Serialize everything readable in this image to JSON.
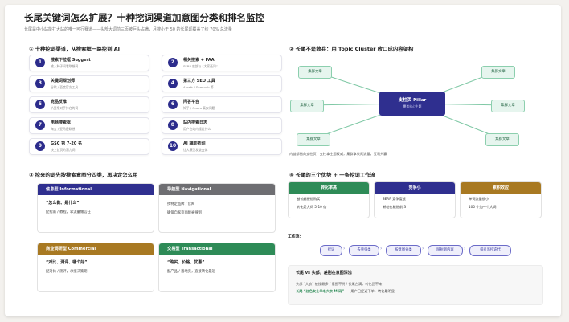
{
  "title": "长尾关键词怎么扩展？十种挖词渠道加意图分类和排名监控",
  "subtitle": "长尾是中小站能打大站的唯一可行赛道——头部大词前三页被巨头占满，月搜小于 50 的长尾却覆盖了约 70% 总流量",
  "section1": {
    "heading": "① 十种挖词渠道，从搜索框一路挖到 AI",
    "cards": [
      {
        "num": "1",
        "title": "搜索下拉框 Suggest",
        "sub": "输入种子词看联想词"
      },
      {
        "num": "2",
        "title": "相关搜索 + PAA",
        "sub": "SERP 底部与 “大家还问”"
      },
      {
        "num": "3",
        "title": "关键词规划师",
        "sub": "谷歌 / 百度官方工具"
      },
      {
        "num": "4",
        "title": "第三方 SEO 工具",
        "sub": "Ahrefs / Semrush 等"
      },
      {
        "num": "5",
        "title": "竞品反推",
        "sub": "扒竞争对手排名的词"
      },
      {
        "num": "6",
        "title": "问答平台",
        "sub": "知乎 / Quora 真实问题"
      },
      {
        "num": "7",
        "title": "电商搜索框",
        "sub": "淘宝 / 亚马逊联想"
      },
      {
        "num": "8",
        "title": "站内搜索日志",
        "sub": "用户在站内搜过什么"
      },
      {
        "num": "9",
        "title": "GSC 第 7-20 名",
        "sub": "快上首页的潜力词"
      },
      {
        "num": "10",
        "title": "AI 辅助拓词",
        "sub": "让大模型发散变体"
      }
    ]
  },
  "section2": {
    "heading": "② 长尾不是散兵：用 Topic Cluster 收口成内容架构",
    "pillar_title": "支柱页 Pillar",
    "pillar_sub": "覆盖核心主题",
    "cluster_label": "集群文章",
    "note": "内链都指向支柱页：支柱拿主题权威，集群拿长尾流量，互利共赢"
  },
  "section3": {
    "heading": "③ 挖来的词先按搜索意图分四类，再决定怎么用",
    "intents": [
      {
        "name": "信息型 Informational",
        "q": "“怎么做、是什么”",
        "d": "配指南 / 教程，拿流量做信任",
        "color": "#2f2f8f"
      },
      {
        "name": "导航型 Navigational",
        "q": "",
        "d1": "找特定品牌 / 官网",
        "d2": "确保自家页面能被搜到",
        "color": "#6e6e72"
      },
      {
        "name": "商业调研型 Commercial",
        "q": "“对比、测评、哪个好”",
        "d": "配对比 / 测评，承接决策期",
        "color": "#a87922"
      },
      {
        "name": "交易型 Transactional",
        "q": "“购买、价格、优惠”",
        "d": "配产品 / 落地页，直接转化最近",
        "color": "#2e8b57"
      }
    ]
  },
  "section4": {
    "heading": "④ 长尾的三个优势 + 一条挖词工作流",
    "advantages": [
      {
        "title": "转化率高",
        "l1": "越长越接近购买",
        "l2": "转化是大词 5-10 倍",
        "color": "#2e8b57"
      },
      {
        "title": "竞争小",
        "l1": "SERP 竞争度低",
        "l2": "新站也能进前 3",
        "color": "#2f2f8f"
      },
      {
        "title": "累积效应",
        "l1": "单词流量很小",
        "l2": "100 个加一个大词",
        "color": "#a87922"
      }
    ],
    "workflow_label": "工作流：",
    "steps": [
      "挖词",
      "去重归类",
      "按意图分类",
      "映射到内容",
      "排名监控迭代"
    ],
    "tail_heading": "长尾 vs 头部，差别在意图深浅",
    "tail_row1": "头部 “大衣” 被搜最多 / 意图不明 / 长尾占满，转化回不来",
    "tail_row2_prefix": "长尾 “红色女士羊毛大衣 M 码”",
    "tail_row2_suffix": "——用户已经近下单，转化最明显"
  }
}
